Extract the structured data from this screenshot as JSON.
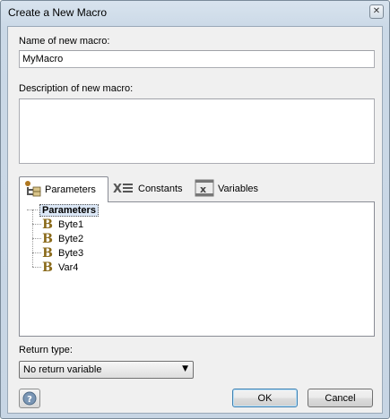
{
  "window": {
    "title": "Create a New Macro",
    "close_glyph": "✕"
  },
  "name_field": {
    "label": "Name of new macro:",
    "value": "MyMacro"
  },
  "description_field": {
    "label": "Description of new macro:",
    "value": ""
  },
  "tabs": [
    {
      "label": "Parameters",
      "icon": "parameters-icon",
      "active": true
    },
    {
      "label": "Constants",
      "icon": "constants-icon",
      "active": false
    },
    {
      "label": "Variables",
      "icon": "variables-icon",
      "active": false
    }
  ],
  "tree": {
    "root": "Parameters",
    "items": [
      {
        "label": "Byte1",
        "icon": "b-type-icon"
      },
      {
        "label": "Byte2",
        "icon": "b-type-icon"
      },
      {
        "label": "Byte3",
        "icon": "b-type-icon"
      },
      {
        "label": "Var4",
        "icon": "b-type-icon"
      }
    ],
    "item_glyph": "B"
  },
  "return_type": {
    "label": "Return type:",
    "selected": "No return variable"
  },
  "buttons": {
    "ok": "OK",
    "cancel": "Cancel",
    "help_glyph": "?"
  },
  "colors": {
    "accent": "#3c7fb1",
    "selection": "#dbe7f6"
  }
}
